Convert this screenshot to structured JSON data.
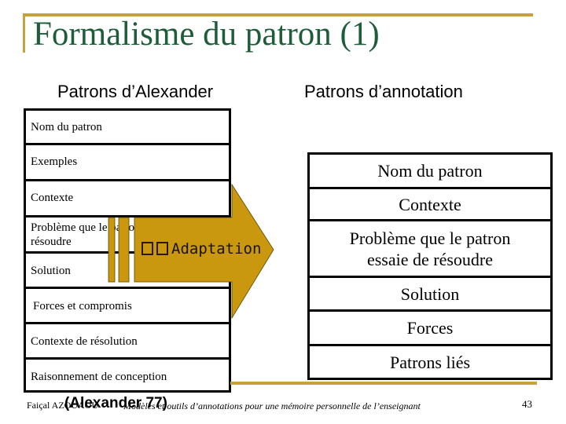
{
  "slide": {
    "title": "Formalisme du patron (1)",
    "accent_color": "#c9a13a",
    "title_color": "#1e5c3a"
  },
  "columns": {
    "left_heading": "Patrons d’Alexander",
    "right_heading": "Patrons d’annotation"
  },
  "alexander_table": {
    "rows": [
      {
        "label": "Nom du patron"
      },
      {
        "label": "Exemples"
      },
      {
        "label": "Contexte"
      },
      {
        "label": "Problème que le patron essaie de résoudre",
        "visible_line1": "Problème que le patron",
        "visible_line2": "résoudre"
      },
      {
        "label": "Solution"
      },
      {
        "label": "Forces et compromis"
      },
      {
        "label": "Contexte de résolution"
      },
      {
        "label": "Raisonnement de conception"
      }
    ]
  },
  "annotation_table": {
    "rows": [
      {
        "line1": "Nom du patron"
      },
      {
        "line1": "Contexte"
      },
      {
        "line1": "Problème que le patron",
        "line2": "essaie de résoudre"
      },
      {
        "line1": "Solution"
      },
      {
        "line1": "Forces"
      },
      {
        "line1": "Patrons liés"
      }
    ]
  },
  "arrow": {
    "label": "Adaptation",
    "fill_color": "#c9980f",
    "icon": "missing-glyph-boxes"
  },
  "footer": {
    "author": "Faiçal AZOUAOU",
    "citation": "(Alexander 77)",
    "course_title": "Modèles et outils d’annotations pour une mémoire personnelle de l’enseignant",
    "page_number": "43"
  }
}
